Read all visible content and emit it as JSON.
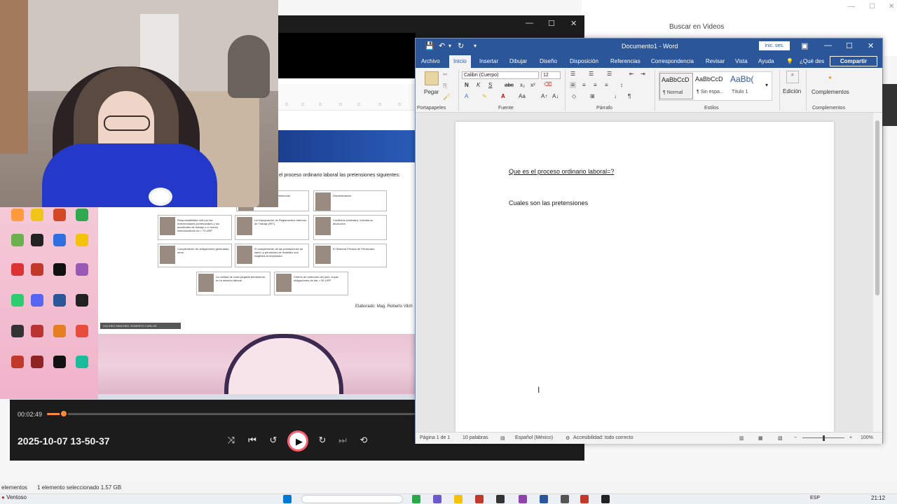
{
  "background_browser": {
    "search_placeholder": "Buscar en Videos",
    "status_items": "elementos",
    "status_selected": "1 elemento seleccionado  1.57 GB"
  },
  "taskbar": {
    "weather": "Ventoso",
    "language": "ESP",
    "time": "21:12"
  },
  "player": {
    "current_time": "00:02:49",
    "progress_fraction": 0.046,
    "video_title": "2025-10-07 13-50-37",
    "slide": {
      "heading": "el proceso ordinario laboral las pretensiones siguientes:",
      "cards": [
        "d por daño extrapatrimonial",
        "Discriminación.",
        "Responsabilidad civil por las enfermedades profesionales y los accidentes de trabajo o el monto indemnizatorio es > 70 URP",
        "La impugnación de Reglamentos Internos de Trabajo (RIT).",
        "Conflictos sindicales, incluida su disolución.",
        "Cumplimiento de obligaciones generadas, otros.",
        "El cumplimiento de las prestaciones de salud, y pensiones de invalidez son exigibles al empleador.",
        "El Sistema Privado de Pensiones.",
        "La nulidad de cosa juzgada fraudulenta en la relación laboral",
        "Criterio de selección del juez: cuyas obligaciones de dar > 50 URP"
      ],
      "credit": "Elaborado: Mag. Roberto Vilch",
      "speaker": "VILCHEZ SANCHEZ, ROBERTO CARLOS"
    }
  },
  "word": {
    "title": "Documento1 - Word",
    "sign_in": "Inic. ses.",
    "tabs": [
      "Archivo",
      "Inicio",
      "Insertar",
      "Dibujar",
      "Diseño",
      "Disposición",
      "Referencias",
      "Correspondencia",
      "Revisar",
      "Vista",
      "Ayuda"
    ],
    "tell_me": "¿Qué des",
    "share": "Compartir",
    "ribbon": {
      "paste": "Pegar",
      "font_name": "Calibri (Cuerpo)",
      "font_size": "12",
      "groups": [
        "Portapapeles",
        "Fuente",
        "Párrafo",
        "Estilos",
        "Complementos"
      ],
      "styles": [
        {
          "sample": "AaBbCcD",
          "name": "¶ Normal"
        },
        {
          "sample": "AaBbCcD",
          "name": "¶ Sin espa..."
        },
        {
          "sample": "AaBb(",
          "name": "Título 1"
        }
      ],
      "edit": "Edición",
      "addins": "Complementos"
    },
    "document": {
      "line1": "Que es el proceso ordinario laboral=?",
      "line2": "Cuales son las pretensiones"
    },
    "status": {
      "page": "Página 1 de 1",
      "words": "10 palabras",
      "language": "Español (México)",
      "accessibility": "Accesibilidad: todo correcto",
      "zoom": "100%"
    }
  },
  "colors": {
    "word_blue": "#2b579a",
    "player_accent": "#ff8a3d",
    "player_bg": "#1c1c1c"
  }
}
